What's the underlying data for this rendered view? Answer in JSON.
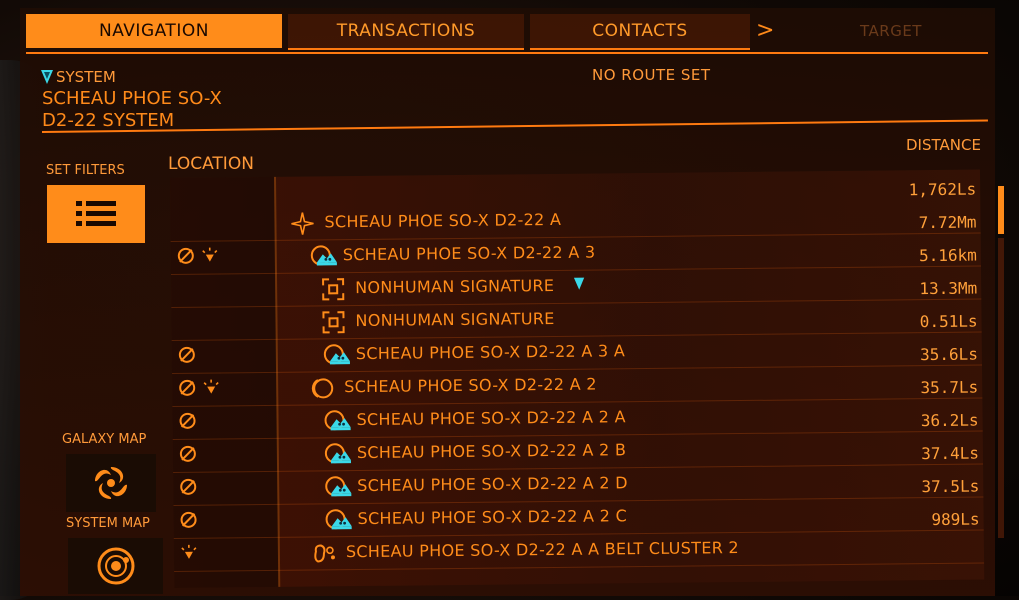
{
  "tabs": [
    {
      "label": "NAVIGATION",
      "active": true
    },
    {
      "label": "TRANSACTIONS",
      "active": false
    },
    {
      "label": "CONTACTS",
      "active": false
    },
    {
      "label": "TARGET",
      "active": false
    }
  ],
  "tab_arrow": ">",
  "system": {
    "label": "SYSTEM",
    "name": "SCHEAU PHOE SO-X D2-22 SYSTEM"
  },
  "route_status": "NO ROUTE SET",
  "sidebar": {
    "set_filters": "SET FILTERS",
    "galaxy_map": "GALAXY MAP",
    "system_map": "SYSTEM MAP"
  },
  "columns": {
    "location": "LOCATION",
    "distance": "DISTANCE"
  },
  "rows": [
    {
      "status": [],
      "icon": "star-icon",
      "name": "SCHEAU PHOE SO-X D2-22 A",
      "distance": "1,762Ls",
      "indent": 0
    },
    {
      "status": [
        "no-scan-icon",
        "discovered-icon"
      ],
      "icon": "landable-planet-icon",
      "name": "SCHEAU PHOE SO-X D2-22 A 3",
      "distance": "7.72Mm",
      "indent": 1
    },
    {
      "status": [],
      "icon": "signal-icon",
      "name": "NONHUMAN SIGNATURE",
      "distance": "5.16km",
      "indent": 2,
      "marker": true
    },
    {
      "status": [],
      "icon": "signal-icon",
      "name": "NONHUMAN SIGNATURE",
      "distance": "13.3Mm",
      "indent": 2
    },
    {
      "status": [
        "no-scan-icon"
      ],
      "icon": "landable-planet-icon",
      "name": "SCHEAU PHOE SO-X D2-22 A 3 A",
      "distance": "0.51Ls",
      "indent": 2
    },
    {
      "status": [
        "no-scan-icon",
        "discovered-icon"
      ],
      "icon": "ring-planet-icon",
      "name": "SCHEAU PHOE SO-X D2-22 A 2",
      "distance": "35.6Ls",
      "indent": 1
    },
    {
      "status": [
        "no-scan-icon"
      ],
      "icon": "landable-planet-icon",
      "name": "SCHEAU PHOE SO-X D2-22 A 2 A",
      "distance": "35.7Ls",
      "indent": 2
    },
    {
      "status": [
        "no-scan-icon"
      ],
      "icon": "landable-planet-icon",
      "name": "SCHEAU PHOE SO-X D2-22 A 2 B",
      "distance": "36.2Ls",
      "indent": 2
    },
    {
      "status": [
        "no-scan-icon"
      ],
      "icon": "landable-planet-icon",
      "name": "SCHEAU PHOE SO-X D2-22 A 2 D",
      "distance": "37.4Ls",
      "indent": 2
    },
    {
      "status": [
        "no-scan-icon"
      ],
      "icon": "landable-planet-icon",
      "name": "SCHEAU PHOE SO-X D2-22 A 2 C",
      "distance": "37.5Ls",
      "indent": 2
    },
    {
      "status": [
        "discovered-icon"
      ],
      "icon": "asteroid-belt-icon",
      "name": "SCHEAU PHOE SO-X D2-22 A A BELT CLUSTER 2",
      "distance": "989Ls",
      "indent": 1
    }
  ],
  "colors": {
    "accent": "#ff8c1a",
    "marker": "#3ad8e8",
    "panel": "#2d0e04"
  }
}
